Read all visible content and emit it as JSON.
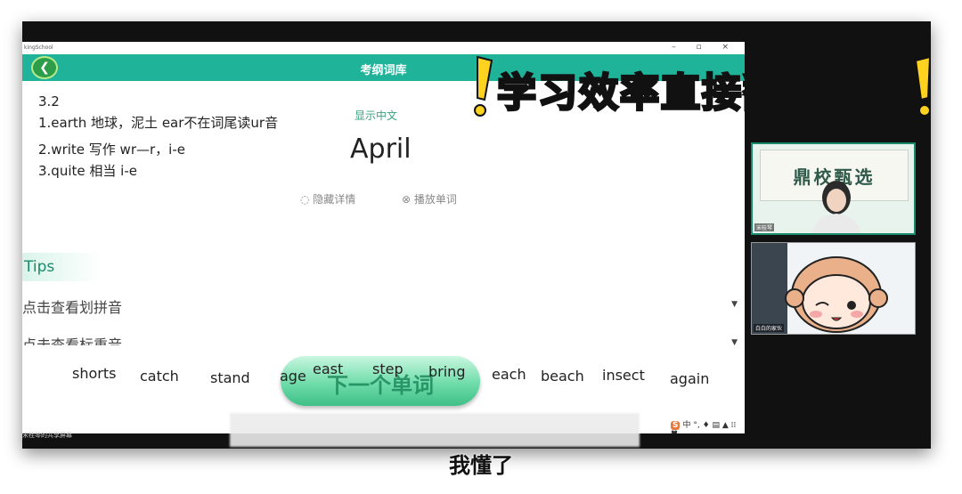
{
  "window": {
    "app_name": "kingSchool",
    "controls": "– ▫ ×"
  },
  "header": {
    "title": "考纲词库",
    "back_icon": "back-arrow-icon"
  },
  "notes": {
    "l0": "3.2",
    "l1": "1.earth 地球，泥土 ear不在词尾读ur音",
    "l2": "2.write 写作  wr—r，i-e",
    "l3": "3.quite 相当 i-e"
  },
  "word_card": {
    "show_chinese": "显示中文",
    "word": "April",
    "hide_details": "隐藏详情",
    "play_word": "播放单词"
  },
  "tips": {
    "title": "Tips",
    "row1": "点击查看划拼音",
    "row2": "点击查看标重音"
  },
  "next_button": {
    "label": "下一个单词"
  },
  "floating_words": [
    "shorts",
    "catch",
    "stand",
    "age",
    "east",
    "step",
    "bring",
    "each",
    "beach",
    "insect",
    "again"
  ],
  "taskbar": {
    "sogou": "S",
    "rest": "中 °, ♦ ▤ ▲ ⁞⁞ ♥"
  },
  "share_label": "宋桂琴的共享屏幕",
  "banner": {
    "text": "学习效率直接翻倍"
  },
  "camera1": {
    "board_text": "鼎校甄选",
    "name": "宋桂琴"
  },
  "camera2": {
    "name": "白白的家伙"
  },
  "subtitle": "我懂了",
  "colors": {
    "header": "#1fb39a",
    "accent": "#3aa17e",
    "banner_yellow": "#ffd21f"
  }
}
